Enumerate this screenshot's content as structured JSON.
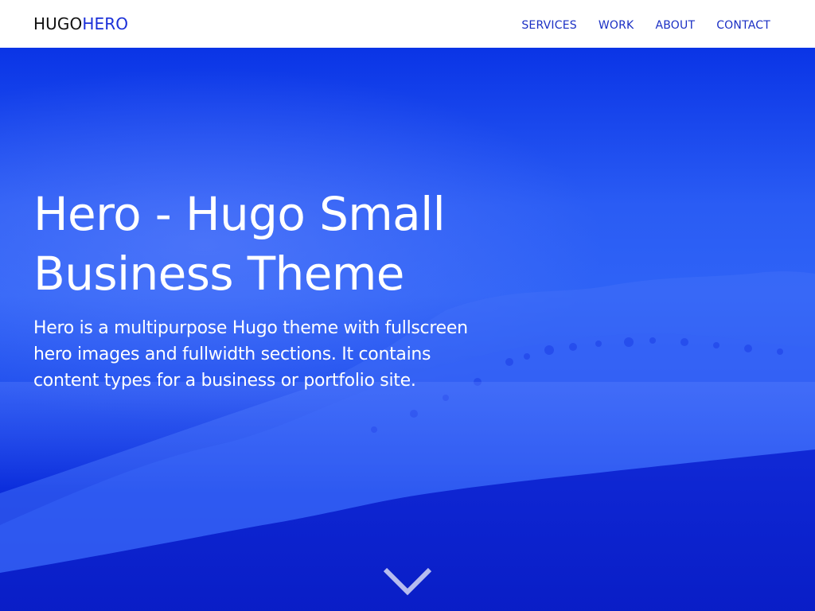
{
  "brand": {
    "part1": "HUGO",
    "part2": "HERO"
  },
  "nav": {
    "items": [
      "SERVICES",
      "WORK",
      "ABOUT",
      "CONTACT"
    ]
  },
  "hero": {
    "title": "Hero - Hugo Small Business Theme",
    "subtitle": "Hero is a multipurpose Hugo theme with fullscreen hero images and fullwidth sections. It contains content types for a business or portfolio site.",
    "scroll_icon": "chevron-down-icon"
  },
  "colors": {
    "accent": "#1a2fd8",
    "hero_overlay": "#0a34e6",
    "nav_text": "#1a2fc4"
  }
}
